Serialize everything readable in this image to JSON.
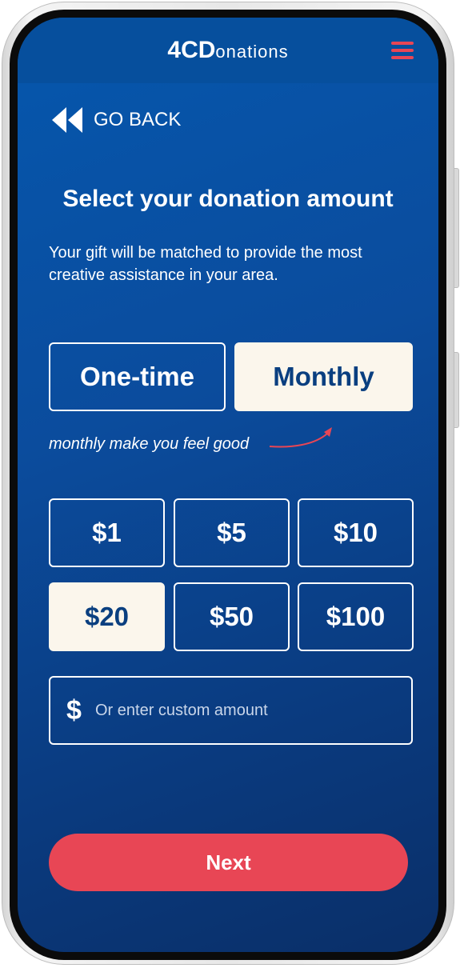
{
  "header": {
    "logo_bold": "4CD",
    "logo_rest": "onations",
    "menu_icon": "hamburger-menu-icon"
  },
  "nav": {
    "back_label": "GO BACK",
    "back_icon": "double-chevron-left-icon"
  },
  "main": {
    "title": "Select your donation amount",
    "subtitle": "Your gift will be matched to provide the most creative assistance in your area."
  },
  "frequency": {
    "options": [
      {
        "label": "One-time",
        "selected": false
      },
      {
        "label": "Monthly",
        "selected": true
      }
    ],
    "note": "monthly make you feel good"
  },
  "amounts": {
    "options": [
      {
        "label": "$1",
        "selected": false
      },
      {
        "label": "$5",
        "selected": false
      },
      {
        "label": "$10",
        "selected": false
      },
      {
        "label": "$20",
        "selected": true
      },
      {
        "label": "$50",
        "selected": false
      },
      {
        "label": "$100",
        "selected": false
      }
    ],
    "custom_prefix": "$",
    "custom_placeholder": "Or enter custom amount"
  },
  "actions": {
    "next_label": "Next"
  },
  "colors": {
    "background_top": "#0557ad",
    "background_bottom": "#0a2f68",
    "accent": "#e84655",
    "selected_fill": "#fbf6ec",
    "selected_text": "#0a3f80"
  }
}
